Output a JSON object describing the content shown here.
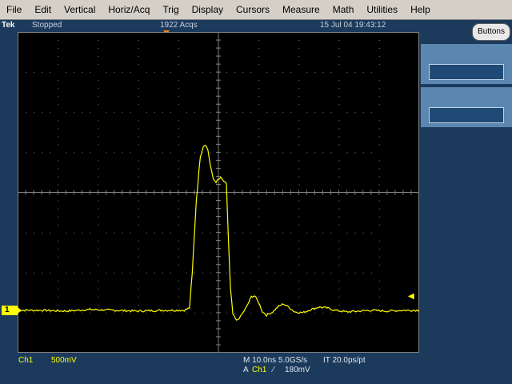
{
  "menu": [
    "File",
    "Edit",
    "Vertical",
    "Horiz/Acq",
    "Trig",
    "Display",
    "Cursors",
    "Measure",
    "Math",
    "Utilities",
    "Help"
  ],
  "status": {
    "brand": "Tek",
    "state": "Stopped",
    "acquisitions": "1922 Acqs",
    "datetime": "15 Jul 04 19:43:12"
  },
  "channel": {
    "marker": "1",
    "label": "Ch1",
    "scale": "500mV"
  },
  "horizontal": {
    "timebase": "M 10.0ns 5.0GS/s",
    "interpolation": "IT 20.0ps/pt"
  },
  "trigger": {
    "mode": "A",
    "source": "Ch1",
    "slope": "⁄",
    "level": "180mV"
  },
  "right_panel": {
    "buttons_label": "Buttons"
  },
  "colors": {
    "trace": "#ffff00",
    "grid": "#7f7f7f",
    "background": "#000000",
    "trigger_marker": "#ff8a1e"
  },
  "waveform": {
    "x_units": "ns",
    "y_units": "V",
    "x_range": [
      -50,
      50
    ],
    "y_range": [
      -2.0,
      2.0
    ],
    "baseline_v": -1.47,
    "points": [
      [
        -50,
        -1.47
      ],
      [
        -44,
        -1.47
      ],
      [
        -38,
        -1.48
      ],
      [
        -32,
        -1.46
      ],
      [
        -26,
        -1.47
      ],
      [
        -20,
        -1.48
      ],
      [
        -14,
        -1.47
      ],
      [
        -8.5,
        -1.47
      ],
      [
        -7.2,
        -1.44
      ],
      [
        -6.5,
        -1.0
      ],
      [
        -5.5,
        -0.1
      ],
      [
        -4.5,
        0.45
      ],
      [
        -3.8,
        0.57
      ],
      [
        -3.3,
        0.6
      ],
      [
        -2.6,
        0.53
      ],
      [
        -2.0,
        0.33
      ],
      [
        -1.3,
        0.17
      ],
      [
        -0.6,
        0.13
      ],
      [
        0.0,
        0.16
      ],
      [
        0.6,
        0.18
      ],
      [
        1.3,
        0.14
      ],
      [
        2.0,
        0.1
      ],
      [
        2.5,
        -0.6
      ],
      [
        3.0,
        -1.2
      ],
      [
        3.6,
        -1.52
      ],
      [
        4.5,
        -1.6
      ],
      [
        5.5,
        -1.55
      ],
      [
        7.0,
        -1.43
      ],
      [
        8.2,
        -1.3
      ],
      [
        9.0,
        -1.29
      ],
      [
        10.0,
        -1.37
      ],
      [
        11.0,
        -1.49
      ],
      [
        12.0,
        -1.53
      ],
      [
        13.5,
        -1.49
      ],
      [
        15.0,
        -1.42
      ],
      [
        16.2,
        -1.39
      ],
      [
        17.5,
        -1.43
      ],
      [
        19.0,
        -1.49
      ],
      [
        21.0,
        -1.5
      ],
      [
        23.0,
        -1.46
      ],
      [
        25.0,
        -1.43
      ],
      [
        27.0,
        -1.44
      ],
      [
        29.0,
        -1.47
      ],
      [
        32.0,
        -1.49
      ],
      [
        35.0,
        -1.48
      ],
      [
        38.0,
        -1.47
      ],
      [
        42.0,
        -1.48
      ],
      [
        46.0,
        -1.47
      ],
      [
        50.0,
        -1.47
      ]
    ]
  }
}
